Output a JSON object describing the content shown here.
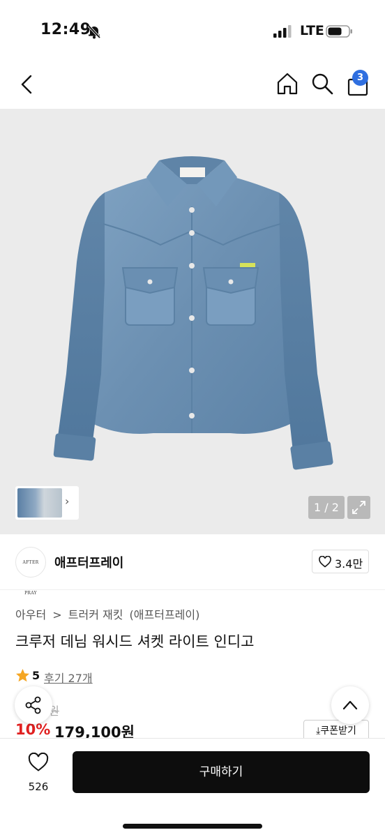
{
  "status_bar": {
    "time": "12:49",
    "network": "LTE"
  },
  "nav": {
    "cart_count": "3"
  },
  "gallery": {
    "page_counter": "1 / 2"
  },
  "brand": {
    "logo_text": "AFTER PRAY",
    "name": "애프터프레이",
    "likes": "3.4만"
  },
  "product": {
    "breadcrumb": [
      "아우터",
      ">",
      "트러커 재킷",
      "(애프터프레이)"
    ],
    "title": "크루저 데님 워시드 셔켓 라이트 인디고",
    "rating": "5",
    "reviews": "후기 27개",
    "original_price": "0원",
    "discount": "10%",
    "sale_price": "179,100원",
    "coupon_label": "쿠폰받기"
  },
  "bottom_bar": {
    "wish_count": "526",
    "buy_label": "구매하기"
  },
  "colors": {
    "accent_blue": "#2f6fe0",
    "discount_red": "#e02020",
    "buy_button": "#0d0d0d",
    "denim": "#6f93b4"
  }
}
